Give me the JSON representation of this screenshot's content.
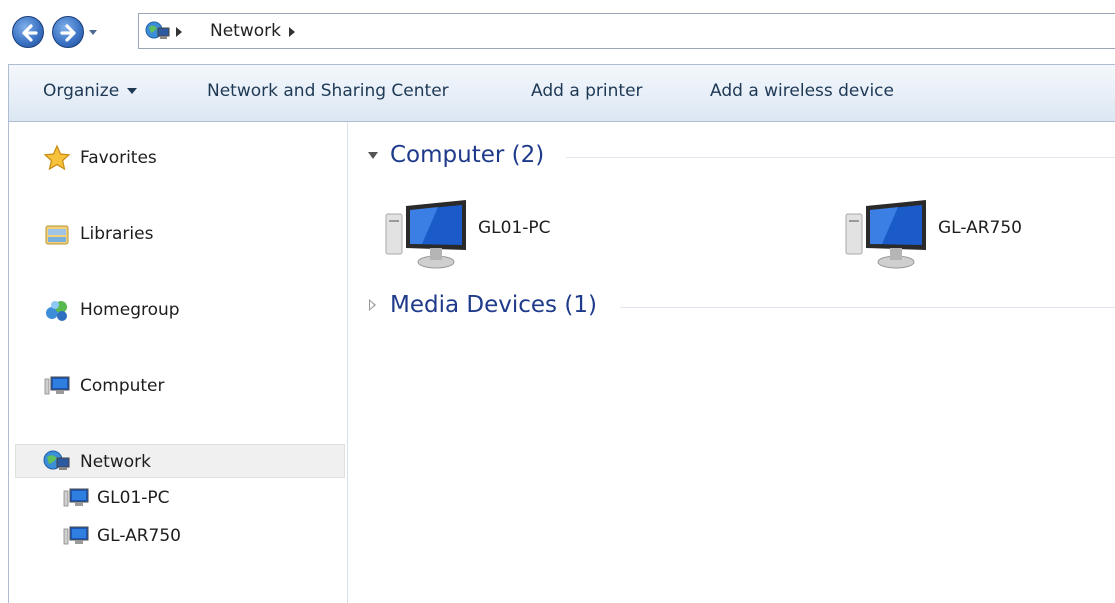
{
  "address_bar": {
    "breadcrumb": [
      "Network"
    ]
  },
  "toolbar": {
    "organize_label": "Organize",
    "network_sharing_label": "Network and Sharing Center",
    "add_printer_label": "Add a printer",
    "add_wireless_label": "Add a wireless device"
  },
  "sidebar": {
    "items": [
      {
        "label": "Favorites",
        "icon": "star-icon"
      },
      {
        "label": "Libraries",
        "icon": "library-icon"
      },
      {
        "label": "Homegroup",
        "icon": "homegroup-icon"
      },
      {
        "label": "Computer",
        "icon": "computer-icon"
      },
      {
        "label": "Network",
        "icon": "network-icon",
        "selected": true
      }
    ],
    "network_children": [
      {
        "label": "GL01-PC",
        "icon": "computer-icon"
      },
      {
        "label": "GL-AR750",
        "icon": "computer-icon"
      }
    ]
  },
  "content": {
    "groups": [
      {
        "title": "Computer (2)",
        "expanded": true,
        "items": [
          {
            "label": "GL01-PC",
            "icon": "computer-icon"
          },
          {
            "label": "GL-AR750",
            "icon": "computer-icon"
          }
        ]
      },
      {
        "title": "Media Devices (1)",
        "expanded": false,
        "items": []
      }
    ]
  },
  "colors": {
    "group_header": "#1e3a8a",
    "toolbar_text": "#1e3955",
    "selected_bg": "#f0f0f0"
  }
}
